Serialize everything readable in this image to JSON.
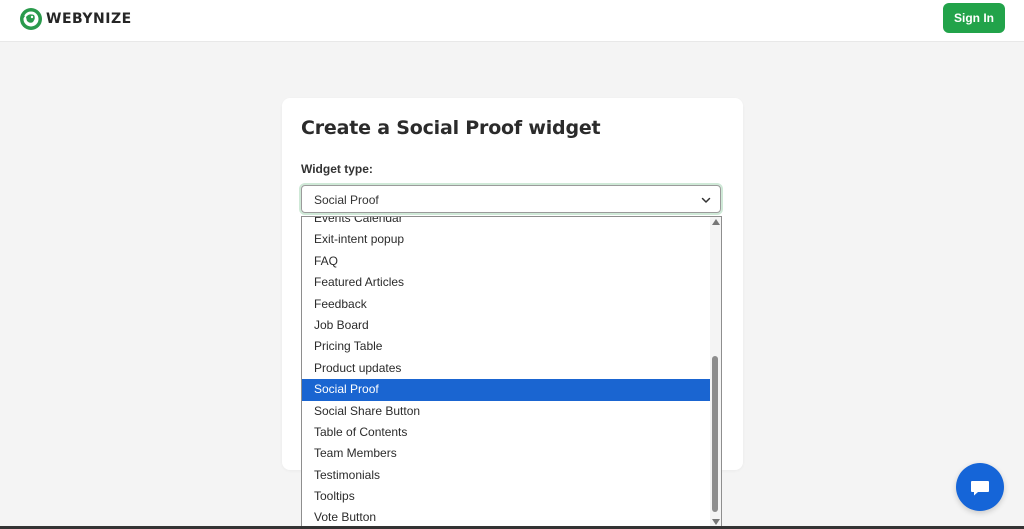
{
  "header": {
    "brand": "WEBYNIZE",
    "sign_in_label": "Sign In"
  },
  "form": {
    "title": "Create a Social Proof widget",
    "widget_type_label": "Widget type:",
    "widget_type_value": "Social Proof"
  },
  "dropdown": {
    "options": [
      "Events Calendar",
      "Exit-intent popup",
      "FAQ",
      "Featured Articles",
      "Feedback",
      "Job Board",
      "Pricing Table",
      "Product updates",
      "Social Proof",
      "Social Share Button",
      "Table of Contents",
      "Team Members",
      "Testimonials",
      "Tooltips",
      "Vote Button"
    ],
    "selected": "Social Proof"
  },
  "colors": {
    "brand_green": "#22a34a",
    "selection_blue": "#1a65d1",
    "chat_blue": "#1565d8"
  },
  "icons": {
    "logo": "webynize-logo-icon",
    "select_chevron": "chevron-down-icon",
    "chat": "chat-bubble-icon"
  }
}
